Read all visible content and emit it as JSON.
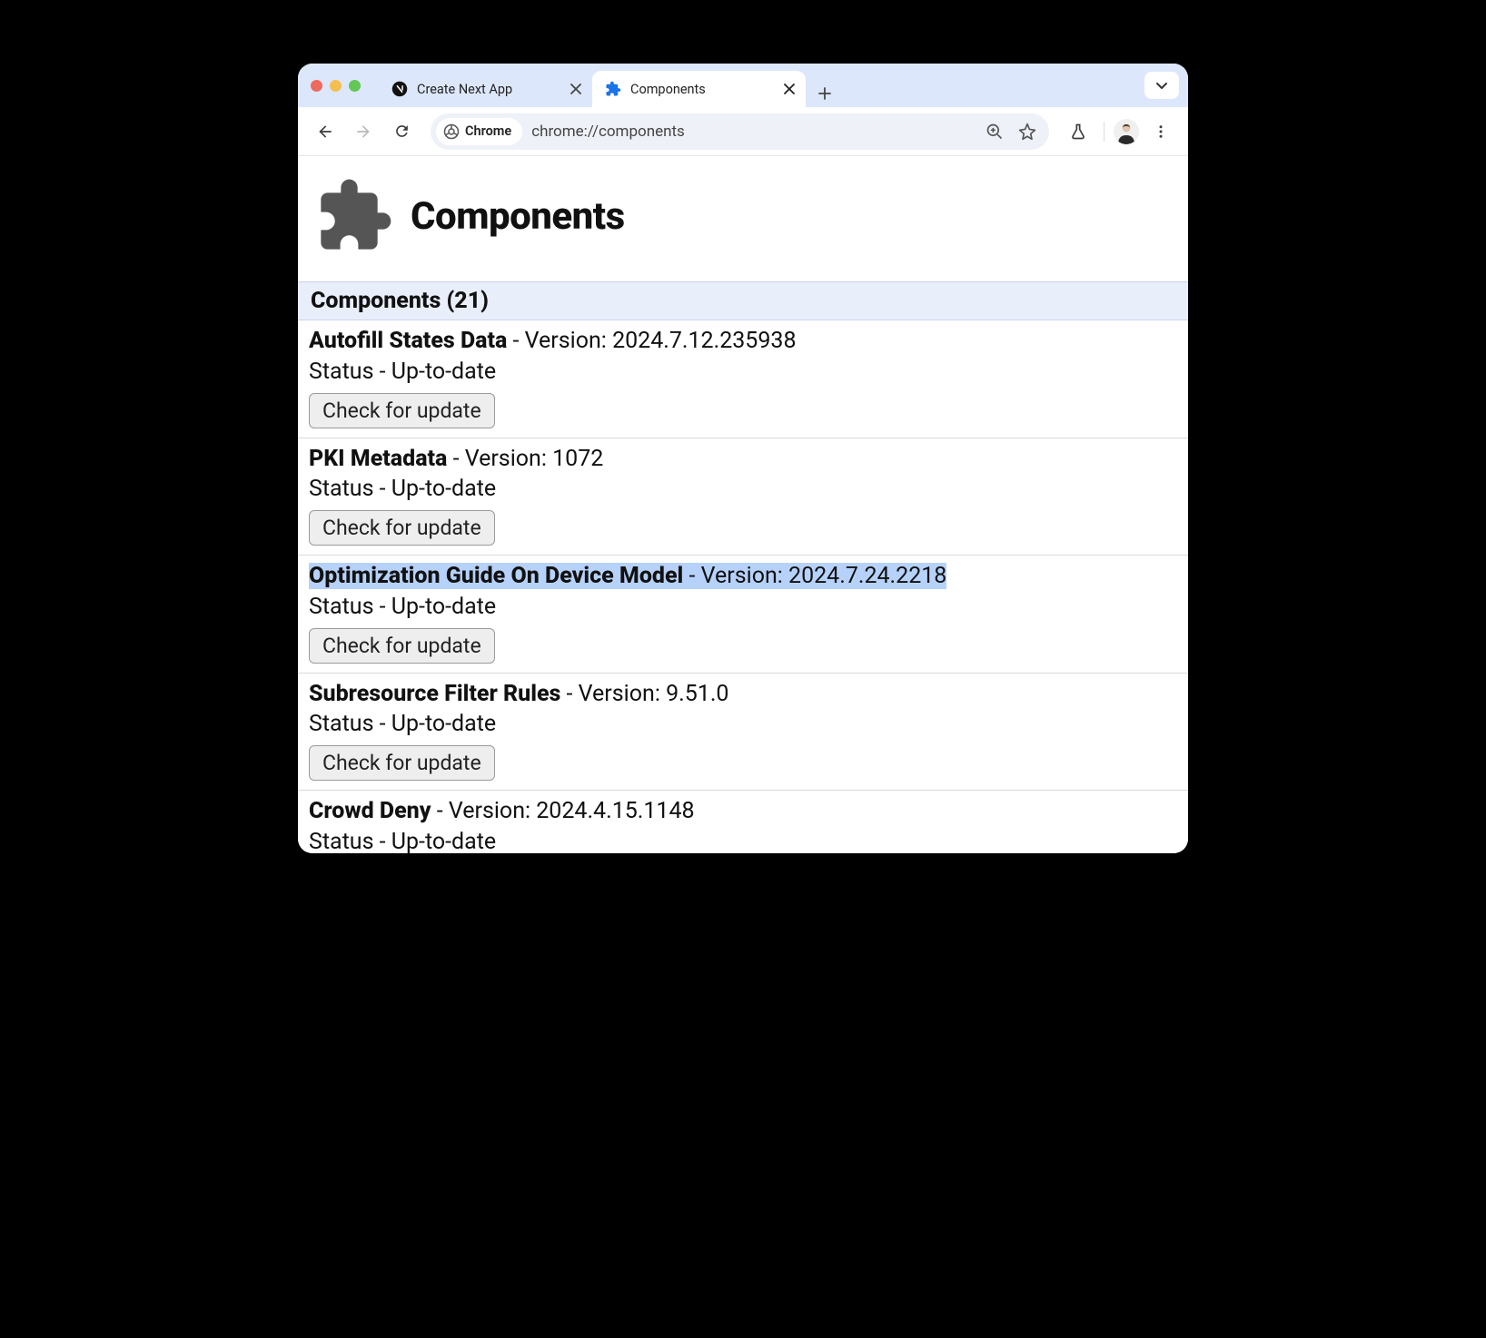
{
  "tabs": [
    {
      "title": "Create Next App",
      "active": false
    },
    {
      "title": "Components",
      "active": true
    }
  ],
  "toolbar": {
    "chip_label": "Chrome",
    "url": "chrome://components"
  },
  "page": {
    "title": "Components",
    "section_label": "Components (21)",
    "version_prefix": " - Version: ",
    "status_prefix": "Status - ",
    "check_button_label": "Check for update",
    "components": [
      {
        "name": "Autofill States Data",
        "version": "2024.7.12.235938",
        "status": "Up-to-date",
        "highlighted": false
      },
      {
        "name": "PKI Metadata",
        "version": "1072",
        "status": "Up-to-date",
        "highlighted": false
      },
      {
        "name": "Optimization Guide On Device Model",
        "version": "2024.7.24.2218",
        "status": "Up-to-date",
        "highlighted": true
      },
      {
        "name": "Subresource Filter Rules",
        "version": "9.51.0",
        "status": "Up-to-date",
        "highlighted": false
      },
      {
        "name": "Crowd Deny",
        "version": "2024.4.15.1148",
        "status": "Up-to-date",
        "highlighted": false
      }
    ]
  }
}
